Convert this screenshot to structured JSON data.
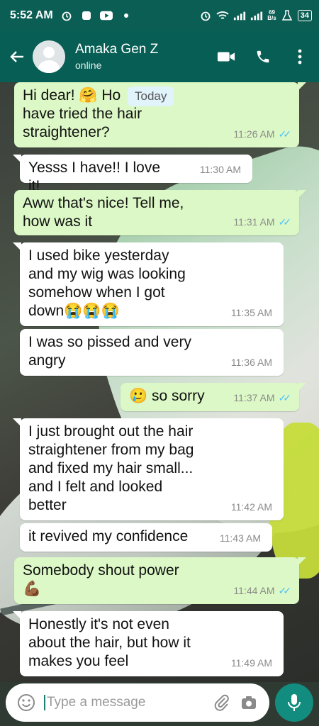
{
  "status_bar": {
    "time": "5:52 AM",
    "net_speed_top": "69",
    "net_speed_bottom": "B/s",
    "battery": "34"
  },
  "header": {
    "contact_name": "Amaka Gen Z",
    "contact_status": "online"
  },
  "chat": {
    "date_chip": "Today",
    "messages": [
      {
        "direction": "out",
        "text": "Hi dear! 🤗 How have you? Have you tried the hair straightener?",
        "line1": "Hi dear! 🤗 Ho",
        "line2": "have tried the hair",
        "line3": "straightener?",
        "time": "11:26 AM",
        "read": "✓✓"
      },
      {
        "direction": "in",
        "text": "Yesss I have!! I love it!",
        "time": "11:30 AM"
      },
      {
        "direction": "out",
        "line1": "Aww that's nice! Tell me,",
        "line2": "how was it",
        "time": "11:31 AM",
        "read": "✓✓"
      },
      {
        "direction": "in",
        "line1": "I used bike yesterday",
        "line2": "and my wig was looking",
        "line3": "somehow when I got",
        "line4": "down😭😭😭",
        "time": "11:35 AM"
      },
      {
        "direction": "in",
        "line1": "I was so pissed and very",
        "line2": "angry",
        "time": "11:36 AM"
      },
      {
        "direction": "out",
        "text": "🥲 so sorry",
        "time": "11:37 AM",
        "read": "✓✓"
      },
      {
        "direction": "in",
        "line1": "I just brought out the hair",
        "line2": "straightener from my bag",
        "line3": "and fixed my hair small...",
        "line4": "and I felt and looked",
        "line5": "better",
        "time": "11:42 AM"
      },
      {
        "direction": "in",
        "text": "it revived my confidence",
        "time": "11:43 AM"
      },
      {
        "direction": "out",
        "line1": "Somebody shout power",
        "line2": "💪🏾",
        "time": "11:44 AM",
        "read": "✓✓"
      },
      {
        "direction": "in",
        "line1": "Honestly it's not even",
        "line2": "about the hair, but how it",
        "line3": "makes you feel",
        "time": "11:49 AM"
      }
    ]
  },
  "input": {
    "placeholder": "Type a message"
  },
  "icons": [
    "back-arrow-icon",
    "video-call-icon",
    "phone-icon",
    "more-vert-icon",
    "emoji-icon",
    "attach-icon",
    "camera-icon",
    "mic-icon"
  ],
  "colors": {
    "header": "#075e54",
    "status_bar": "#0b5e54",
    "outgoing_bubble": "#dcf8c6",
    "incoming_bubble": "#ffffff",
    "read_ticks": "#4fc3f7",
    "mic_button": "#128c7e"
  }
}
